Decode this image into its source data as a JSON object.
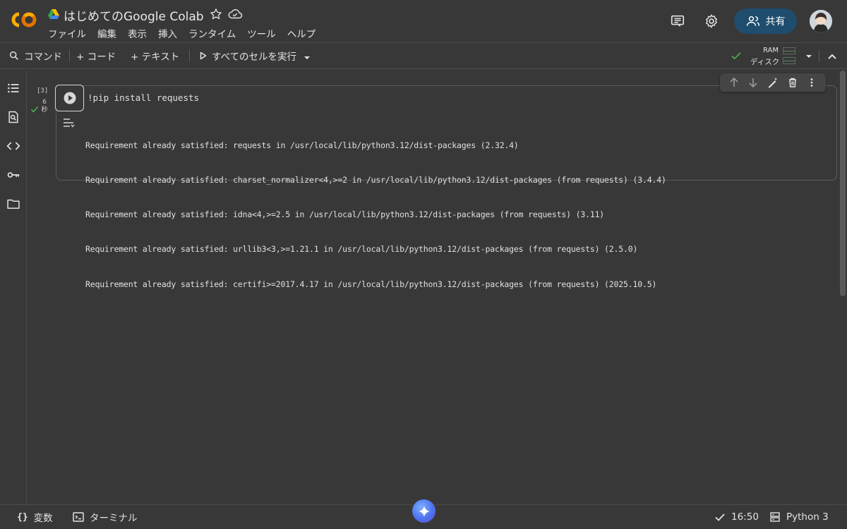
{
  "header": {
    "title": "はじめてのGoogle Colab",
    "menu": [
      "ファイル",
      "編集",
      "表示",
      "挿入",
      "ランタイム",
      "ツール",
      "ヘルプ"
    ],
    "share_label": "共有"
  },
  "toolbar": {
    "command_label": "コマンド",
    "add_code_label": "+ コード",
    "add_text_label": "+ テキスト",
    "run_all_label": "すべてのセルを実行",
    "ram_label": "RAM",
    "disk_label": "ディスク"
  },
  "cell": {
    "execution_count": "[3]",
    "exec_time_value": "6",
    "exec_time_unit": "秒",
    "code": "!pip install requests",
    "output": [
      "Requirement already satisfied: requests in /usr/local/lib/python3.12/dist-packages (2.32.4)",
      "Requirement already satisfied: charset_normalizer<4,>=2 in /usr/local/lib/python3.12/dist-packages (from requests) (3.4.4)",
      "Requirement already satisfied: idna<4,>=2.5 in /usr/local/lib/python3.12/dist-packages (from requests) (3.11)",
      "Requirement already satisfied: urllib3<3,>=1.21.1 in /usr/local/lib/python3.12/dist-packages (from requests) (2.5.0)",
      "Requirement already satisfied: certifi>=2017.4.17 in /usr/local/lib/python3.12/dist-packages (from requests) (2025.10.5)"
    ]
  },
  "statusbar": {
    "variables_label": "変数",
    "terminal_label": "ターミナル",
    "time": "16:50",
    "runtime_label": "Python 3"
  },
  "colors": {
    "background": "#383838",
    "share_button": "#1f4d6e",
    "logo_orange": "#f9ab00",
    "logo_dark_orange": "#e37400",
    "success_green": "#4caf50"
  }
}
